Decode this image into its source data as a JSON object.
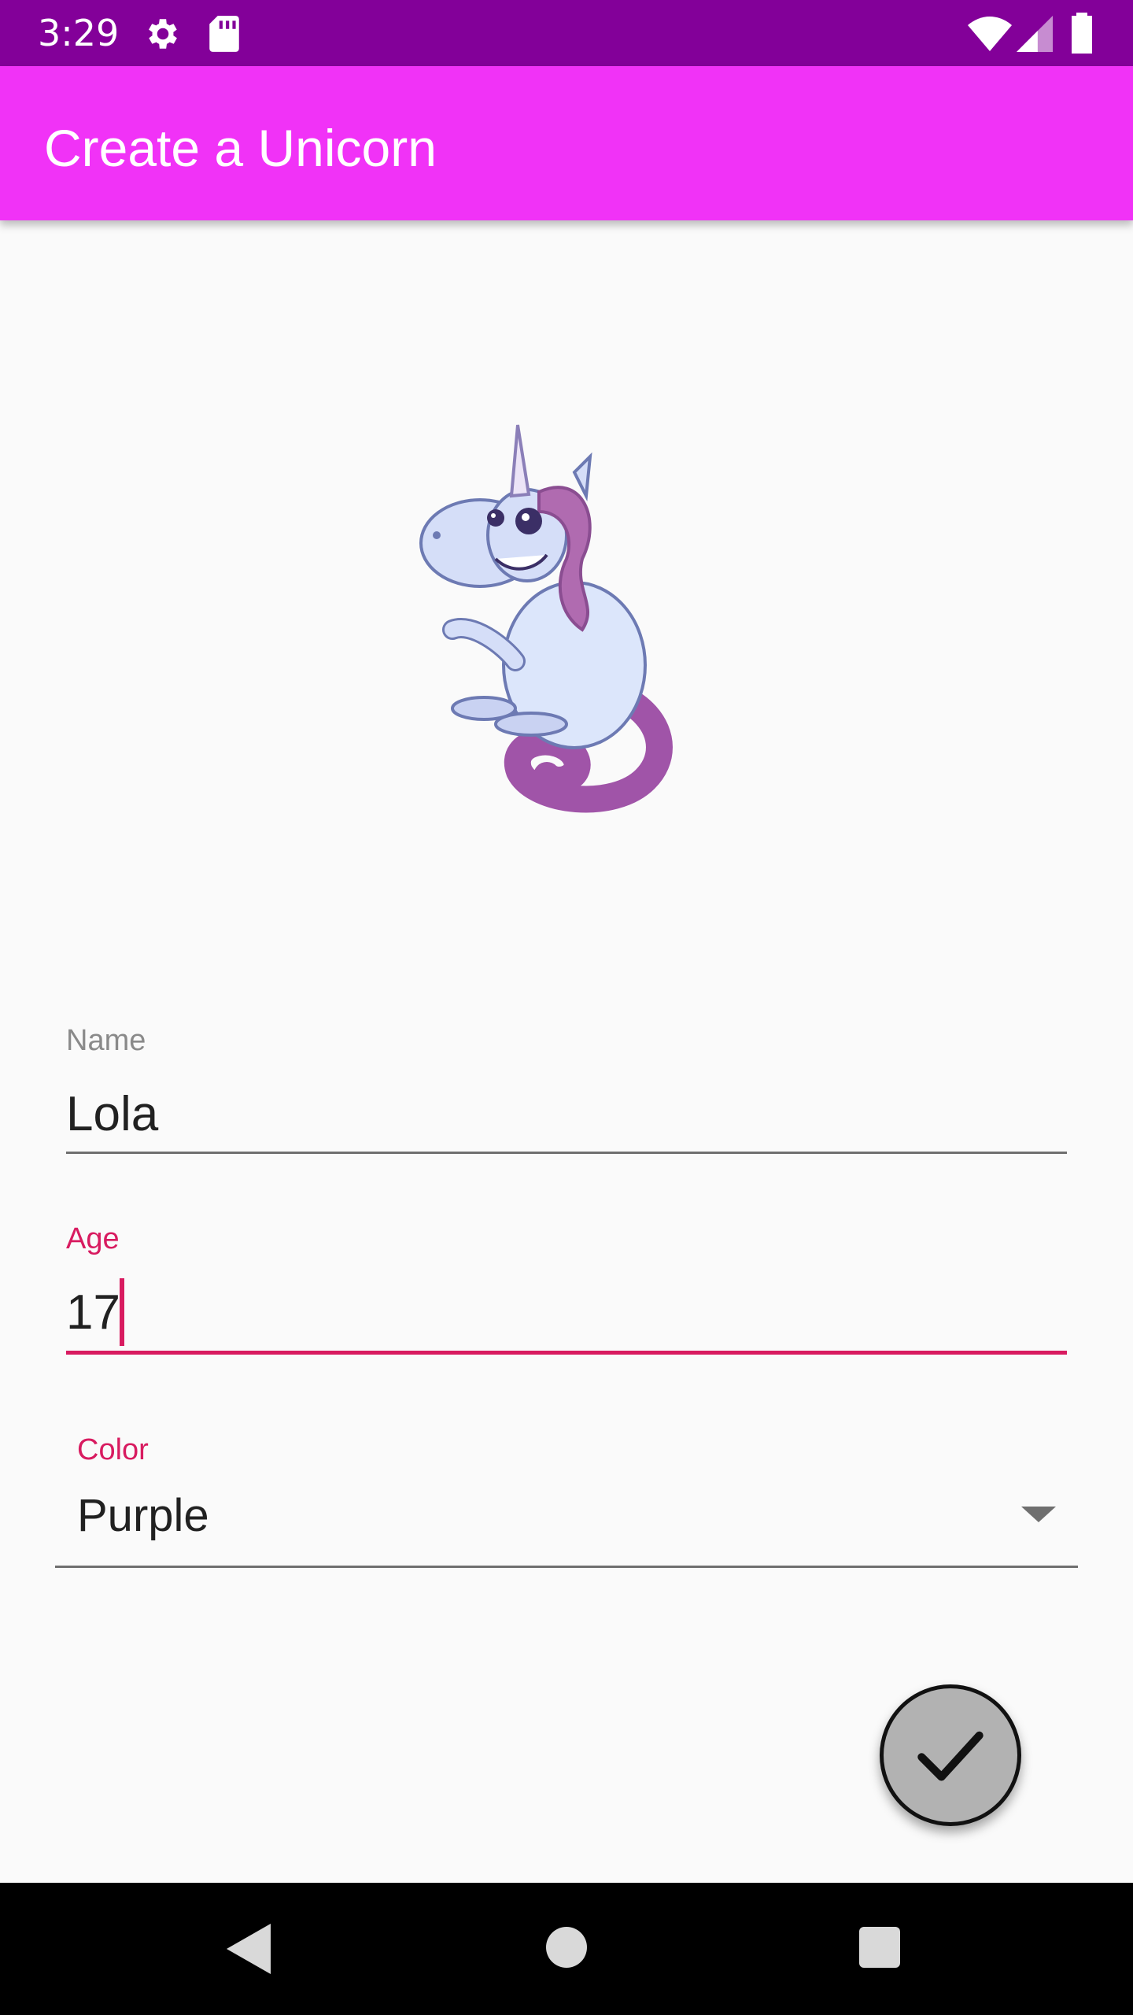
{
  "status_bar": {
    "time": "3:29",
    "icons": [
      "settings-icon",
      "sd-card-icon",
      "wifi-icon",
      "signal-icon",
      "battery-icon"
    ]
  },
  "app_bar": {
    "title": "Create a Unicorn",
    "background": "#f132f7"
  },
  "image": {
    "icon": "unicorn-illustration"
  },
  "form": {
    "name": {
      "label": "Name",
      "value": "Lola"
    },
    "age": {
      "label": "Age",
      "value": "17"
    },
    "color": {
      "label": "Color",
      "selected": "Purple"
    }
  },
  "fab": {
    "icon": "checkmark-icon"
  },
  "nav_bar": {
    "icons": [
      "back-icon",
      "home-icon",
      "recents-icon"
    ]
  },
  "colors": {
    "status_bar": "#830099",
    "accent": "#d81b60",
    "fab": "#b2b2b2"
  }
}
